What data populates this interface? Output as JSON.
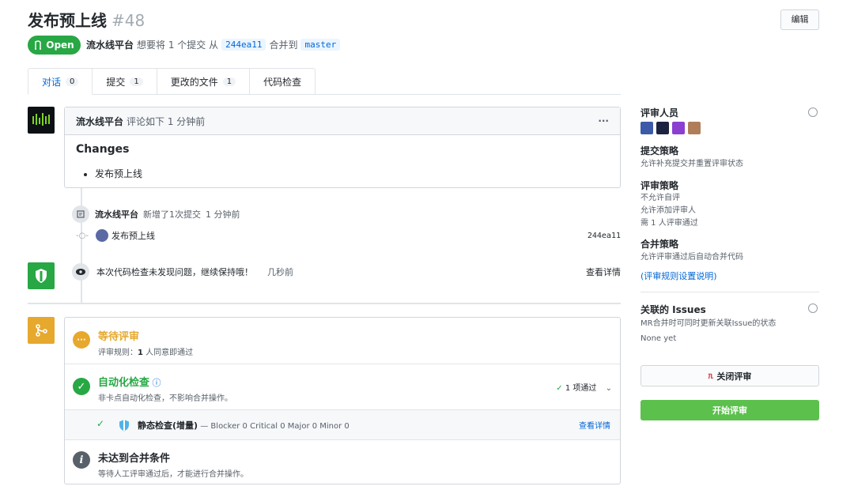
{
  "header": {
    "title": "发布预上线",
    "number": "#48",
    "edit_label": "编辑",
    "status": "Open",
    "author": "流水线平台",
    "desc_mid": "想要将 1 个提交 从",
    "source_branch": "244ea11",
    "desc_merge": "合并到",
    "target_branch": "master"
  },
  "tabs": [
    {
      "label": "对话",
      "count": "0"
    },
    {
      "label": "提交",
      "count": "1"
    },
    {
      "label": "更改的文件",
      "count": "1"
    },
    {
      "label": "代码检查",
      "count": ""
    }
  ],
  "comment": {
    "author": "流水线平台",
    "meta": "评论如下 1 分钟前",
    "menu": "···",
    "heading": "Changes",
    "bullet": "发布预上线"
  },
  "timeline": {
    "commit_event_author": "流水线平台",
    "commit_event_text": "新增了1次提交",
    "commit_event_time": "1 分钟前",
    "commit_message": "发布预上线",
    "commit_hash": "244ea11",
    "check_text": "本次代码检查未发现问题，继续保持哦！",
    "check_time": "几秒前",
    "check_link": "查看详情"
  },
  "merge": {
    "review_title": "等待评审",
    "review_rule_label": "评审规则：",
    "review_rule_value": "1",
    "review_rule_suffix": "人同意即通过",
    "auto_title": "自动化检查",
    "auto_sub": "非卡点自动化检查，不影响合并操作。",
    "auto_status": "1 项通过",
    "static_name": "静态检查(增量)",
    "static_detail": "— Blocker 0 Critical 0 Major 0 Minor 0",
    "static_link": "查看详情",
    "cond_title": "未达到合并条件",
    "cond_sub": "等待人工评审通过后，才能进行合并操作。"
  },
  "sidebar": {
    "reviewers_title": "评审人员",
    "submit_policy_title": "提交策略",
    "submit_policy_text": "允许补充提交并重置评审状态",
    "review_policy_title": "评审策略",
    "review_policy_lines": [
      "不允许自评",
      "允许添加评审人",
      "需 1 人评审通过"
    ],
    "merge_policy_title": "合并策略",
    "merge_policy_text": "允许评审通过后自动合并代码",
    "rules_link": "(评审规则设置说明)",
    "issues_title": "关联的 Issues",
    "issues_text": "MR合并时可同时更新关联Issue的状态",
    "issues_empty": "None yet",
    "close_label": "关闭评审",
    "start_label": "开始评审"
  },
  "colors": {
    "accent_blue": "#0366d6",
    "open_green": "#28a745",
    "start_green": "#5cc04d",
    "pending_orange": "#e6a82d"
  }
}
